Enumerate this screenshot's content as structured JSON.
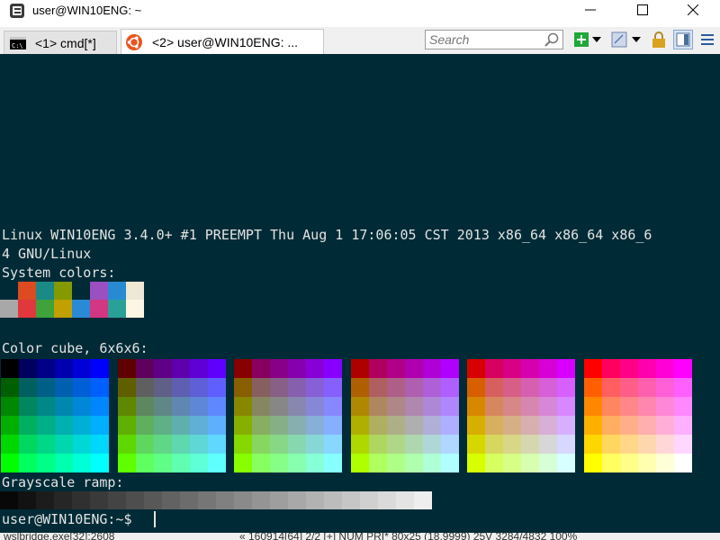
{
  "window": {
    "title": "user@WIN10ENG: ~",
    "app_icon": "conemu-icon",
    "controls": [
      "minimize-icon",
      "maximize-icon",
      "close-icon"
    ]
  },
  "tabs": [
    {
      "label": "<1> cmd[*]",
      "icon": "cmd-icon",
      "active": false
    },
    {
      "label": "<2> user@WIN10ENG: ...",
      "icon": "ubuntu-icon",
      "active": true
    }
  ],
  "toolbar": {
    "search_placeholder": "Search",
    "icons": [
      "search-icon",
      "new-console-icon",
      "dropdown-icon",
      "paste-icon",
      "dropdown-icon",
      "lock-icon",
      "split-icon",
      "menu-icon"
    ],
    "colors": {
      "new_console": "#1fa83a",
      "lock": "#d9a21e"
    }
  },
  "terminal": {
    "background": "#002b36",
    "foreground": "#e3e3e3",
    "uname_line1": "Linux WIN10ENG 3.4.0+ #1 PREEMPT Thu Aug 1 17:06:05 CST 2013 x86_64 x86_64 x86_6",
    "uname_line2": "4 GNU/Linux",
    "system_colors_label": "System colors:",
    "system_colors_row1": [
      "#002b36",
      "#dc4b22",
      "#1a8a87",
      "#859900",
      "#002b36",
      "#9b4fc0",
      "#268bd2",
      "#eee8d5"
    ],
    "system_colors_row2": [
      "#a8a8a8",
      "#e0383c",
      "#3fa23a",
      "#c2a000",
      "#2a8ad6",
      "#d33682",
      "#2aa198",
      "#fdf6e3"
    ],
    "color_cube_label": "Color cube, 6x6x6:",
    "grayscale_label": "Grayscale ramp:",
    "prompt": "user@WIN10ENG:~$ "
  },
  "statusbar": {
    "left": "wslbridge.exe[32]:2608",
    "right": "« 160914[64]   2/2   [+] NUM   PRI*   80x25   (18,9999) 25V   3284/4832   100%"
  }
}
